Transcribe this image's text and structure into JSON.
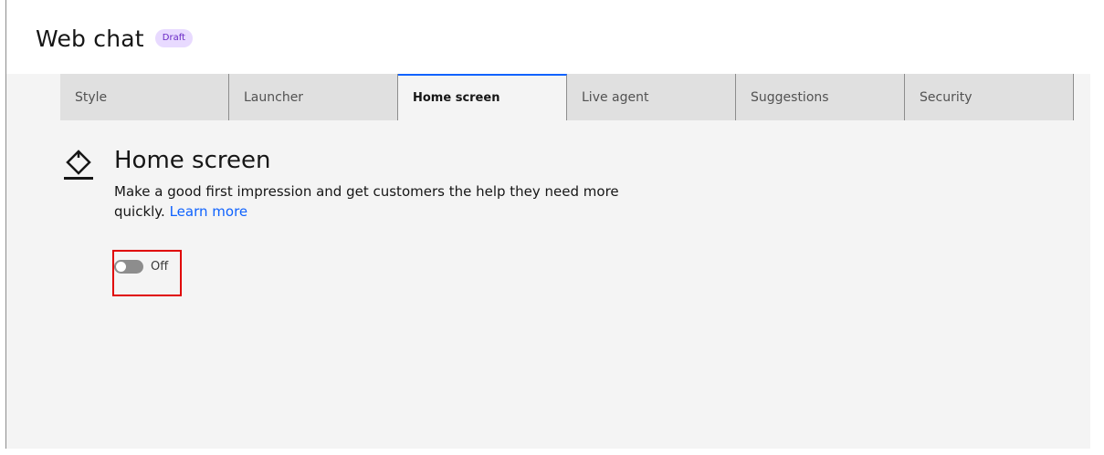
{
  "header": {
    "title": "Web chat",
    "badge": "Draft"
  },
  "tabs": [
    {
      "label": "Style",
      "active": false
    },
    {
      "label": "Launcher",
      "active": false
    },
    {
      "label": "Home screen",
      "active": true
    },
    {
      "label": "Live agent",
      "active": false
    },
    {
      "label": "Suggestions",
      "active": false
    },
    {
      "label": "Security",
      "active": false
    }
  ],
  "section": {
    "icon": "paint-bucket-icon",
    "title": "Home screen",
    "description": "Make a good first impression and get customers the help they need more quickly.",
    "link": "Learn more"
  },
  "toggle": {
    "state": "off",
    "label": "Off"
  },
  "colors": {
    "accent": "#0f62fe",
    "badge_bg": "#e8daff",
    "badge_text": "#6929c4",
    "highlight": "#e00000"
  }
}
